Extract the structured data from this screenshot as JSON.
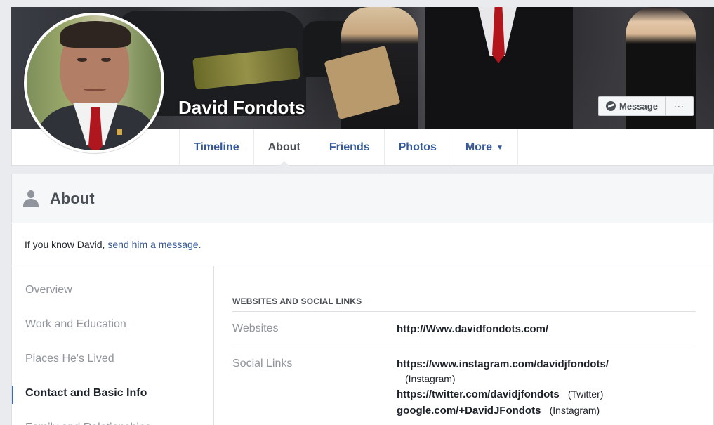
{
  "profile": {
    "name": "David Fondots"
  },
  "cover_actions": {
    "message_label": "Message",
    "more_label": "···"
  },
  "tabs": [
    {
      "label": "Timeline"
    },
    {
      "label": "About"
    },
    {
      "label": "Friends"
    },
    {
      "label": "Photos"
    },
    {
      "label": "More"
    }
  ],
  "about": {
    "title": "About",
    "prompt_prefix": "If you know David,",
    "prompt_link": "send him a message."
  },
  "side_nav": [
    {
      "label": "Overview"
    },
    {
      "label": "Work and Education"
    },
    {
      "label": "Places He's Lived"
    },
    {
      "label": "Contact and Basic Info"
    },
    {
      "label": "Family and Relationships"
    }
  ],
  "websites_section": {
    "heading": "WEBSITES AND SOCIAL LINKS",
    "websites_label": "Websites",
    "website": "http://Www.davidfondots.com/",
    "social_label": "Social Links",
    "social_links": [
      {
        "url": "https://www.instagram.com/davidjfondots/",
        "source": "(Instagram)"
      },
      {
        "url": "https://twitter.com/davidjfondots",
        "source": "(Twitter)"
      },
      {
        "url": "google.com/+DavidJFondots",
        "source": "(Instagram)"
      }
    ]
  }
}
